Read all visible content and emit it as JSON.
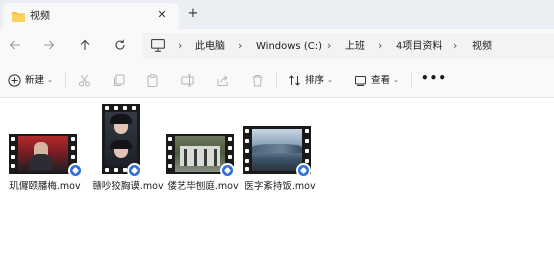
{
  "window": {
    "tab": {
      "title": "视频"
    },
    "new_tab": "+"
  },
  "address": {
    "crumbs": [
      "此电脑",
      "Windows (C:)",
      "上班",
      "4项目资料",
      "视频"
    ]
  },
  "toolbar": {
    "new_label": "新建",
    "sort_label": "排序",
    "view_label": "查看",
    "more_label": "•••"
  },
  "files": [
    {
      "name": "玑儸颐膰梅.mov",
      "orientation": "landscape"
    },
    {
      "name": "赣吵狡胸谟.mov",
      "orientation": "portrait"
    },
    {
      "name": "偻艺毕刨庭.mov",
      "orientation": "landscape"
    },
    {
      "name": "医字紊持饭.mov",
      "orientation": "landscape"
    }
  ],
  "colors": {
    "accent": "#2f6fdb",
    "titlebar": "#ebeef3",
    "pane": "#f9f9f9"
  }
}
